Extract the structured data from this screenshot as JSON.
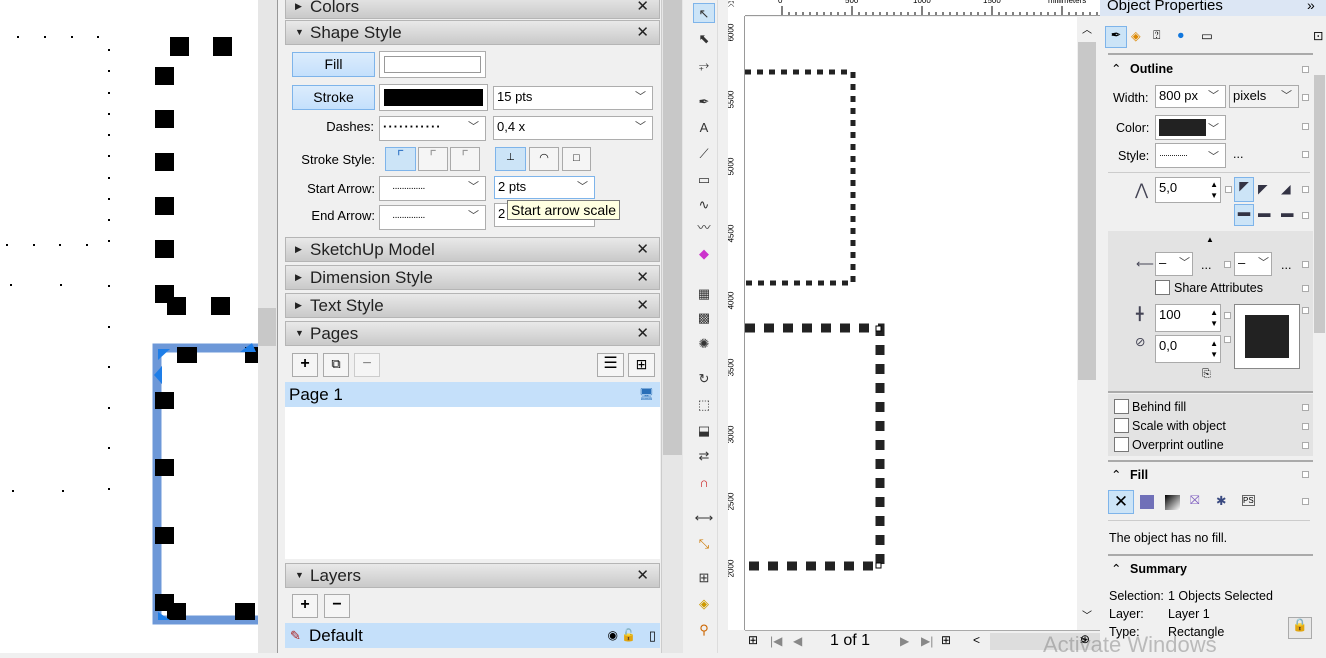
{
  "panels": {
    "colors": "Colors",
    "shape_style": "Shape Style",
    "sketchup_model": "SketchUp Model",
    "dimension_style": "Dimension Style",
    "text_style": "Text Style",
    "pages": "Pages",
    "layers": "Layers"
  },
  "shape_style": {
    "fill_label": "Fill",
    "stroke_label": "Stroke",
    "stroke_width": "15 pts",
    "dashes_label": "Dashes:",
    "dash_scale": "0,4 x",
    "stroke_style_label": "Stroke Style:",
    "start_arrow_label": "Start Arrow:",
    "start_arrow_scale": "2 pts",
    "end_arrow_label": "End Arrow:",
    "end_arrow_scale": "2",
    "tooltip": "Start arrow scale",
    "fill_color": "#ffffff",
    "stroke_color": "#000000"
  },
  "pages": {
    "items": [
      {
        "label": "Page 1"
      }
    ]
  },
  "layers": {
    "items": [
      {
        "label": "Default"
      }
    ]
  },
  "ruler": {
    "top_ticks": [
      "0",
      "500",
      "1000",
      "1500"
    ],
    "units": "millimeters",
    "left_ticks": [
      "6000",
      "5500",
      "5000",
      "4500",
      "4000",
      "3500",
      "3000",
      "2500",
      "2000"
    ]
  },
  "nav": {
    "page_indicator": "1 of 1"
  },
  "watermark": "Activate Windows",
  "props": {
    "title": "Object Properties",
    "outline": "Outline",
    "width_label": "Width:",
    "width_value": "800 px",
    "width_unit": "pixels",
    "color_label": "Color:",
    "style_label": "Style:",
    "ellipsis": "...",
    "miter": "5,0",
    "arrow_left": "–",
    "arrow_right": "–",
    "share_attributes": "Share Attributes",
    "stretch": "100",
    "angle": "0,0",
    "behind_fill": "Behind fill",
    "scale_with_object": "Scale with object",
    "overprint_outline": "Overprint outline",
    "fill": "Fill",
    "fill_status": "The object has no fill.",
    "summary": "Summary",
    "selection_label": "Selection:",
    "selection_value": "1 Objects Selected",
    "layer_label": "Layer:",
    "layer_value": "Layer 1",
    "type_label": "Type:",
    "type_value": "Rectangle",
    "outline_color": "#222222",
    "accent": "#cce4f7"
  }
}
